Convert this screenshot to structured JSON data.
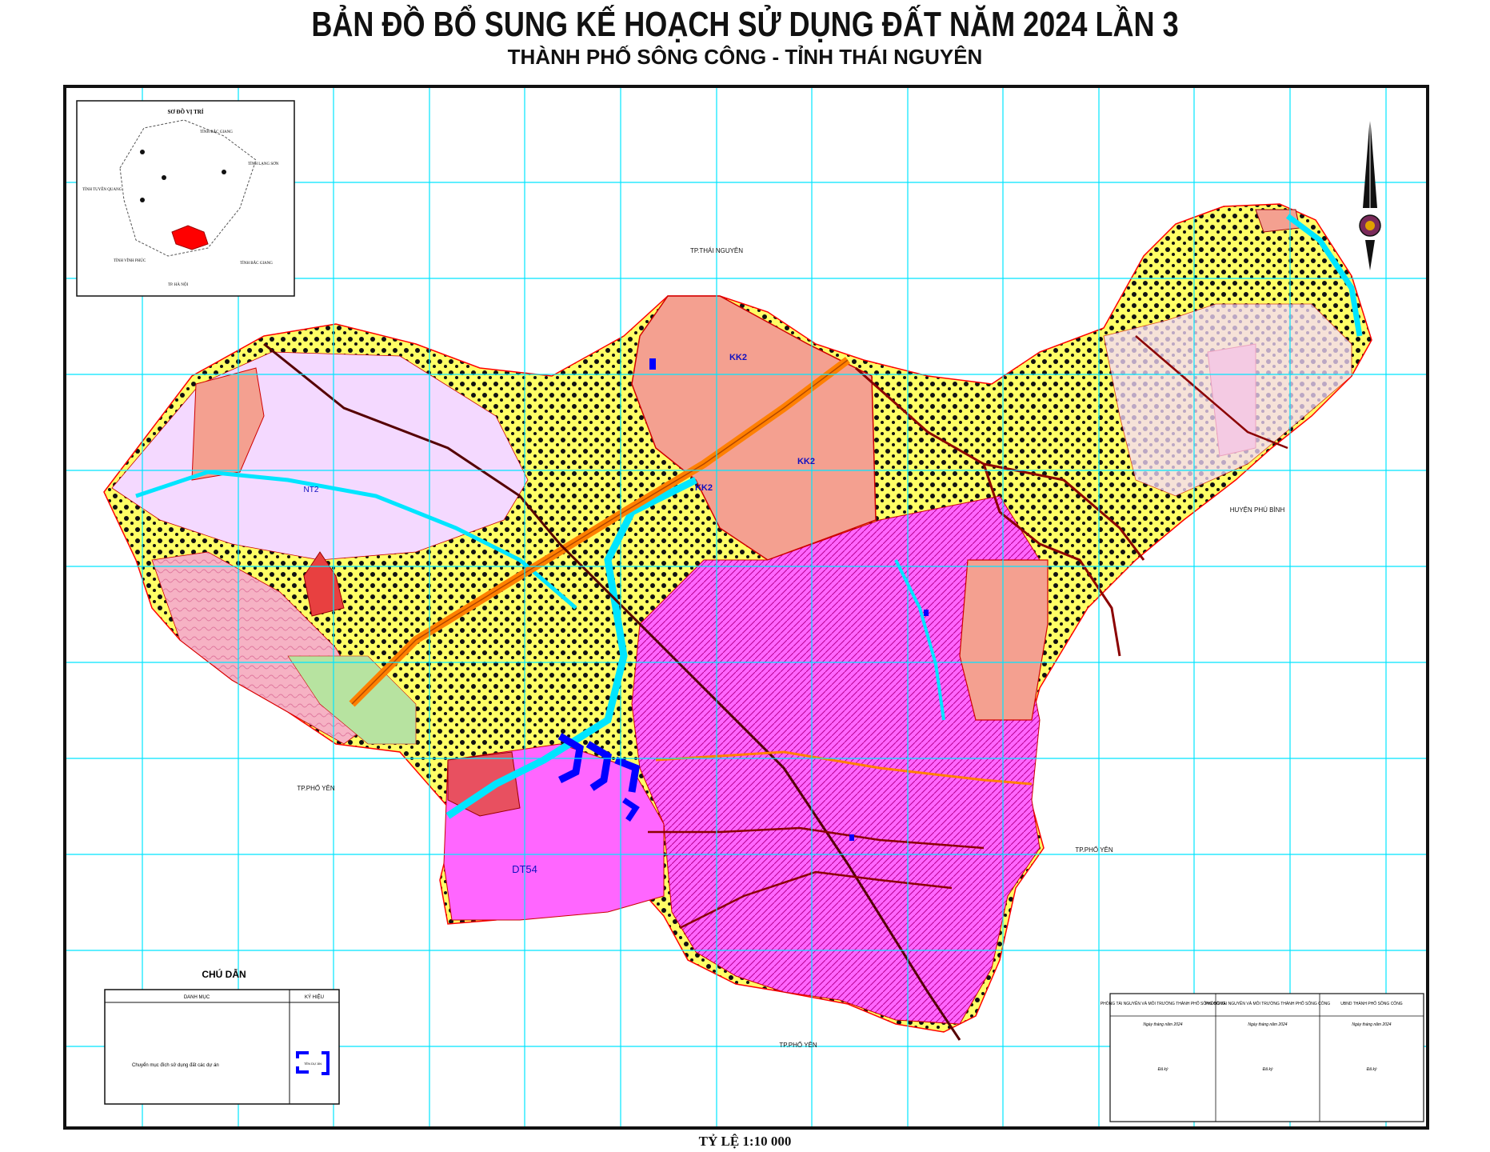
{
  "title": "BẢN ĐỒ BỔ SUNG KẾ HOẠCH SỬ DỤNG ĐẤT NĂM 2024 LẦN 3",
  "subtitle": "THÀNH PHỐ SÔNG CÔNG - TỈNH THÁI NGUYÊN",
  "scale_text": "TỶ LỆ 1:10 000",
  "colors": {
    "grid": "#00e5ff",
    "urban": "#ff66ff",
    "industrial": "#f4a090",
    "forest": "#ffd0e8",
    "agriculture": "#ffff66",
    "residential": "#f4d9ff",
    "road": "#ff8000",
    "river": "#00ffff",
    "highlight": "#0000ff"
  },
  "neighbors": {
    "north": "TP.THÁI NGUYÊN",
    "east": "HUYỆN PHÚ BÌNH",
    "west": "TP.PHỔ YÊN",
    "southeast": "TP.PHỔ YÊN",
    "south": "TP.PHỔ YÊN"
  },
  "zone_labels": {
    "kk2_top": "KK2",
    "kk2_center": "KK2",
    "kk2_left": "KK2",
    "nt2": "NT2",
    "dt54": "DT54"
  },
  "inset": {
    "title": "SƠ ĐỒ VỊ TRÍ",
    "labels": [
      "TỈNH BẮC GIANG",
      "TỈNH LẠNG SƠN",
      "TỈNH TUYÊN QUANG",
      "TỈNH VĨNH PHÚC",
      "TP. HÀ NỘI",
      "TỈNH BẮC GIANG"
    ]
  },
  "legend": {
    "title": "CHÚ DẪN",
    "col_category": "DANH MỤC",
    "col_symbol": "KÝ HIỆU",
    "item_text": "Chuyển mục đích sử dụng đất các dự án",
    "item_symbol_text": "TÊN DỰ ÁN"
  },
  "signatures": [
    {
      "org": "PHÒNG TÀI NGUYÊN VÀ MÔI TRƯỜNG THÀNH PHỐ SÔNG CÔNG",
      "date": "Ngày      tháng    năm 2024",
      "sign": "Đã ký"
    },
    {
      "org": "PHÒNG TÀI NGUYÊN VÀ MÔI TRƯỜNG THÀNH PHỐ SÔNG CÔNG",
      "date": "Ngày      tháng    năm 2024",
      "sign": "Đã ký"
    },
    {
      "org": "UBND THÀNH PHỐ SÔNG CÔNG",
      "date": "Ngày      tháng    năm 2024",
      "sign": "Đã ký"
    }
  ]
}
